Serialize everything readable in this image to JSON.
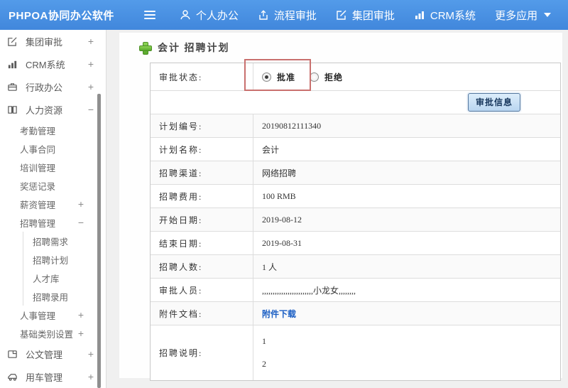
{
  "topbar": {
    "brand": "PHPOA协同办公软件",
    "nav": [
      {
        "label": "个人办公",
        "icon": "user-icon"
      },
      {
        "label": "流程审批",
        "icon": "workflow-icon"
      },
      {
        "label": "集团审批",
        "icon": "edit-icon"
      },
      {
        "label": "CRM系统",
        "icon": "bar-chart-icon"
      },
      {
        "label": "更多应用",
        "icon": "caret-down-icon"
      }
    ]
  },
  "sidebar": {
    "items": [
      {
        "label": "集团审批",
        "level": 1,
        "icon": "edit-icon",
        "toggle": "+"
      },
      {
        "label": "CRM系统",
        "level": 1,
        "icon": "bar-chart-icon",
        "toggle": "+"
      },
      {
        "label": "行政办公",
        "level": 1,
        "icon": "briefcase-icon",
        "toggle": "+"
      },
      {
        "label": "人力资源",
        "level": 1,
        "icon": "book-icon",
        "toggle": "−"
      },
      {
        "label": "考勤管理",
        "level": 2
      },
      {
        "label": "人事合同",
        "level": 2
      },
      {
        "label": "培训管理",
        "level": 2
      },
      {
        "label": "奖惩记录",
        "level": 2
      },
      {
        "label": "薪资管理",
        "level": 2,
        "toggle": "+"
      },
      {
        "label": "招聘管理",
        "level": 2,
        "toggle": "−"
      },
      {
        "label": "招聘需求",
        "level": 3
      },
      {
        "label": "招聘计划",
        "level": 3
      },
      {
        "label": "人才库",
        "level": 3
      },
      {
        "label": "招聘录用",
        "level": 3
      },
      {
        "label": "人事管理",
        "level": 2,
        "toggle": "+"
      },
      {
        "label": "基础类别设置",
        "level": 2,
        "toggle": "+"
      },
      {
        "label": "公文管理",
        "level": 1,
        "icon": "document-icon",
        "toggle": "+"
      },
      {
        "label": "用车管理",
        "level": 1,
        "icon": "car-icon",
        "toggle": "+"
      }
    ]
  },
  "main": {
    "title": "会计 招聘计划",
    "status_row": {
      "label": "审批状态:",
      "options": [
        {
          "label": "批准",
          "selected": true
        },
        {
          "label": "拒绝",
          "selected": false
        }
      ]
    },
    "approval_info_button": "审批信息",
    "fields": [
      {
        "label": "计划编号:",
        "value": "20190812111340"
      },
      {
        "label": "计划名称:",
        "value": "会计"
      },
      {
        "label": "招聘渠道:",
        "value": "网络招聘"
      },
      {
        "label": "招聘费用:",
        "value": "100 RMB"
      },
      {
        "label": "开始日期:",
        "value": "2019-08-12"
      },
      {
        "label": "结束日期:",
        "value": "2019-08-31"
      },
      {
        "label": "招聘人数:",
        "value": "1 人"
      },
      {
        "label": "审批人员:",
        "value": ",,,,,,,,,,,,,,,,,,,,,,,,小龙女,,,,,,,,"
      },
      {
        "label": "附件文档:",
        "value": "附件下载"
      },
      {
        "label": "招聘说明:",
        "lines": [
          "1",
          "2"
        ]
      }
    ]
  },
  "colors": {
    "topbar_blue": "#4a91e2",
    "annotation_red": "#c9706e",
    "link_blue": "#1a5ec4",
    "button_blue_bg": "#c5dcf3",
    "plus_green": "#6abf3a"
  }
}
